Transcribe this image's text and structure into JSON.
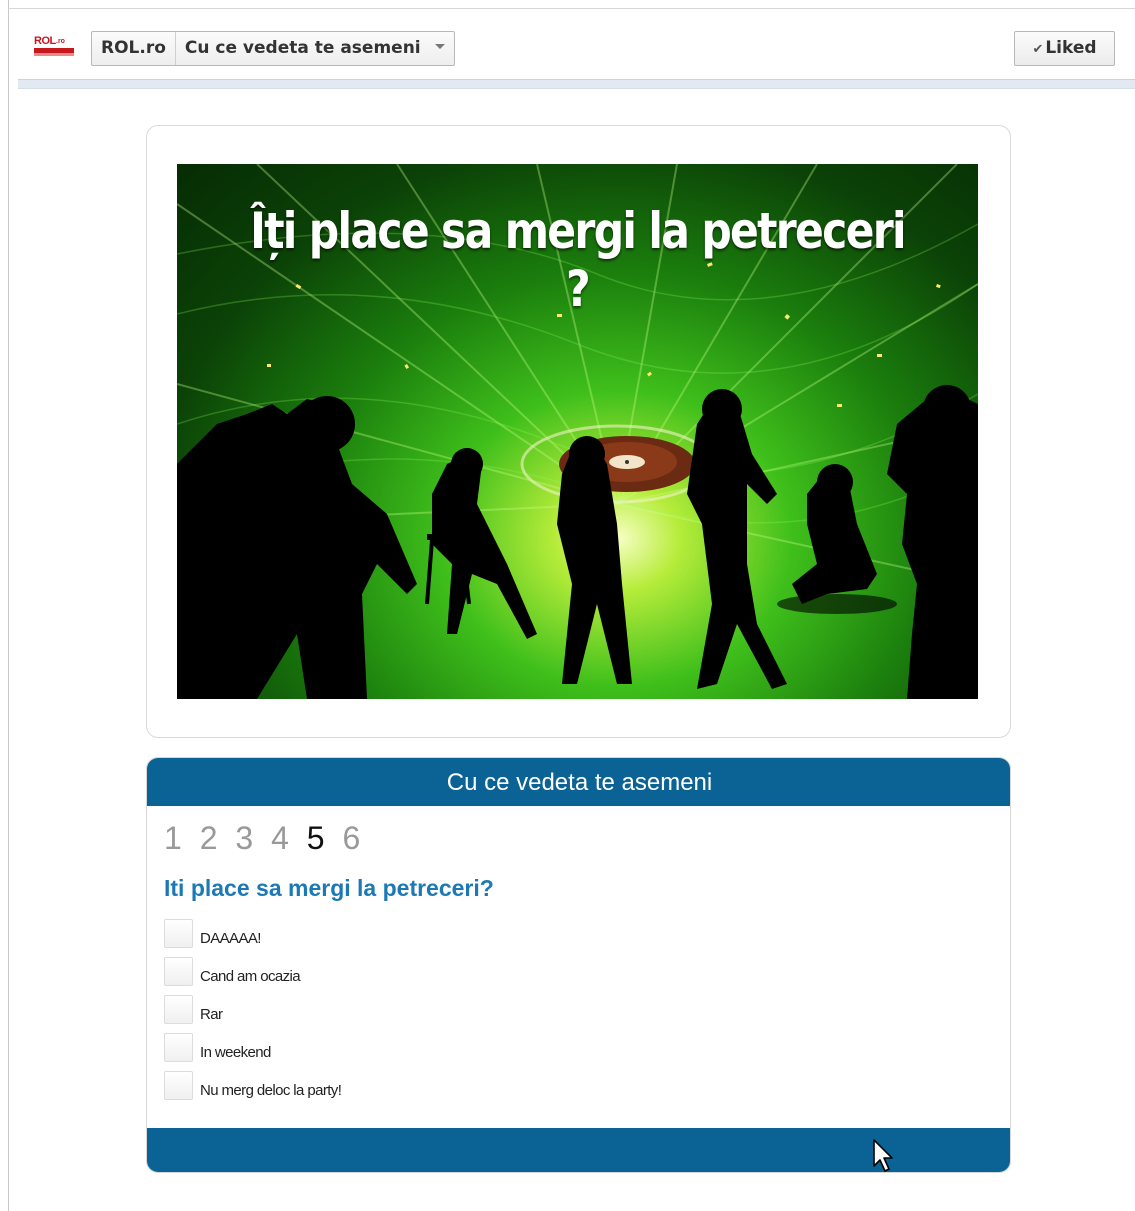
{
  "header": {
    "logo_text": "ROL.ro",
    "site_label": "ROL.ro",
    "app_label": "Cu ce vedeta te asemeni",
    "liked_label": "Liked"
  },
  "banner": {
    "title": "Îți place sa mergi la petreceri ?"
  },
  "quiz": {
    "title": "Cu ce vedeta te asemeni",
    "steps": [
      "1",
      "2",
      "3",
      "4",
      "5",
      "6"
    ],
    "active_step": "5",
    "question": "Iti place sa mergi la petreceri?",
    "answers": [
      "DAAAAA!",
      "Cand am ocazia",
      "Rar",
      "In weekend",
      "Nu merg deloc la party!"
    ]
  },
  "colors": {
    "accent_blue": "#0a6394",
    "question_blue": "#1d79b4",
    "logo_red": "#c8161d"
  },
  "icons": {
    "caret": "chevron-down-icon",
    "check": "check-icon",
    "cursor": "mouse-cursor-icon"
  }
}
